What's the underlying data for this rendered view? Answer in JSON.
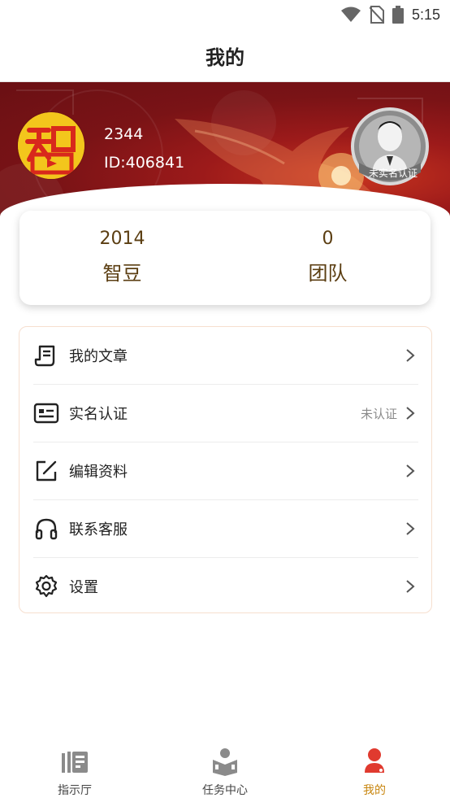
{
  "status_bar": {
    "time": "5:15",
    "icons": [
      "wifi-icon",
      "no-sim-icon",
      "battery-icon"
    ]
  },
  "header": {
    "title": "我的"
  },
  "profile": {
    "name": "2344",
    "id_text": "ID:406841",
    "badge_text": "未实名认证"
  },
  "stats": [
    {
      "value": "2014",
      "label": "智豆"
    },
    {
      "value": "0",
      "label": "团队"
    }
  ],
  "menu": {
    "items": [
      {
        "label": "我的文章",
        "right": "",
        "icon": "article-icon"
      },
      {
        "label": "实名认证",
        "right": "未认证",
        "icon": "id-card-icon"
      },
      {
        "label": "编辑资料",
        "right": "",
        "icon": "edit-icon"
      },
      {
        "label": "联系客服",
        "right": "",
        "icon": "headset-icon"
      },
      {
        "label": "设置",
        "right": "",
        "icon": "gear-icon"
      }
    ]
  },
  "tabbar": {
    "tabs": [
      {
        "label": "指示厅",
        "icon": "newspaper-icon",
        "active": false
      },
      {
        "label": "任务中心",
        "icon": "reader-icon",
        "active": false
      },
      {
        "label": "我的",
        "icon": "user-icon",
        "active": true
      }
    ]
  },
  "colors": {
    "accent": "#e03a2f",
    "active_tab_text": "#c8860f",
    "stat_text": "#5b3e12"
  }
}
